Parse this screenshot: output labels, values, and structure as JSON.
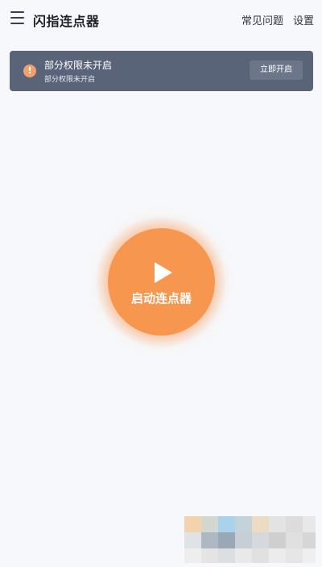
{
  "header": {
    "title": "闪指连点器",
    "faq_label": "常见问题",
    "settings_label": "设置"
  },
  "banner": {
    "title": "部分权限未开启",
    "subtitle": "部分权限未开启",
    "button_label": "立即开启",
    "icon_glyph": "!"
  },
  "main": {
    "start_label": "启动连点器"
  },
  "colors": {
    "accent": "#f7964e",
    "banner_bg": "#5a6478",
    "warning": "#f1a26c"
  }
}
